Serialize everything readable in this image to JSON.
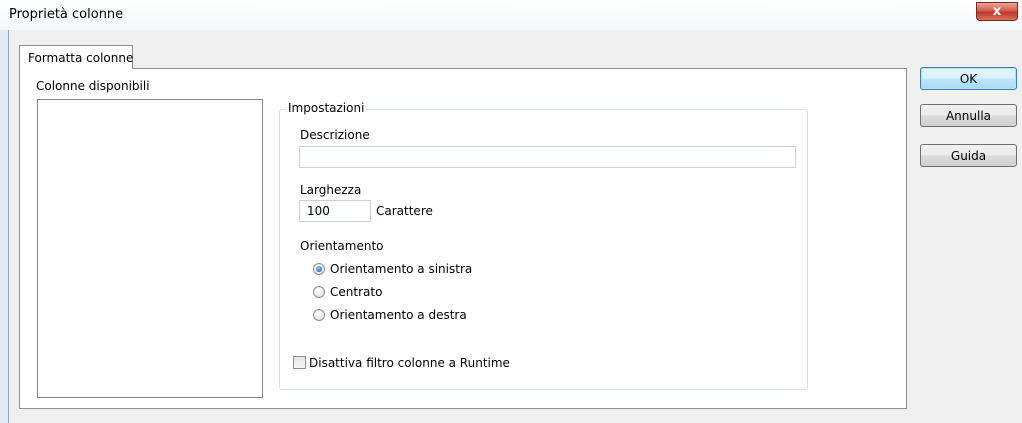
{
  "window": {
    "title": "Proprietà colonne",
    "close_glyph": "x"
  },
  "tabs": [
    {
      "label": "Formatta colonne",
      "selected": true
    }
  ],
  "available_columns": {
    "label": "Colonne disponibili",
    "items": []
  },
  "settings": {
    "group_title": "Impostazioni",
    "description": {
      "label": "Descrizione",
      "value": ""
    },
    "width": {
      "label": "Larghezza",
      "value": "100",
      "unit": "Carattere"
    },
    "orientation": {
      "label": "Orientamento",
      "options": [
        {
          "label": "Orientamento a sinistra",
          "checked": true
        },
        {
          "label": "Centrato",
          "checked": false
        },
        {
          "label": "Orientamento a destra",
          "checked": false
        }
      ]
    },
    "disable_filter": {
      "label": "Disattiva filtro colonne a Runtime",
      "checked": false
    }
  },
  "buttons": {
    "ok": "OK",
    "cancel": "Annulla",
    "help": "Guida"
  },
  "colors": {
    "default_button_border": "#3c7fb1",
    "close_button": "#c0382a",
    "radio_checked": "#2a6ebc"
  },
  "icons": {
    "close": "close-icon"
  }
}
